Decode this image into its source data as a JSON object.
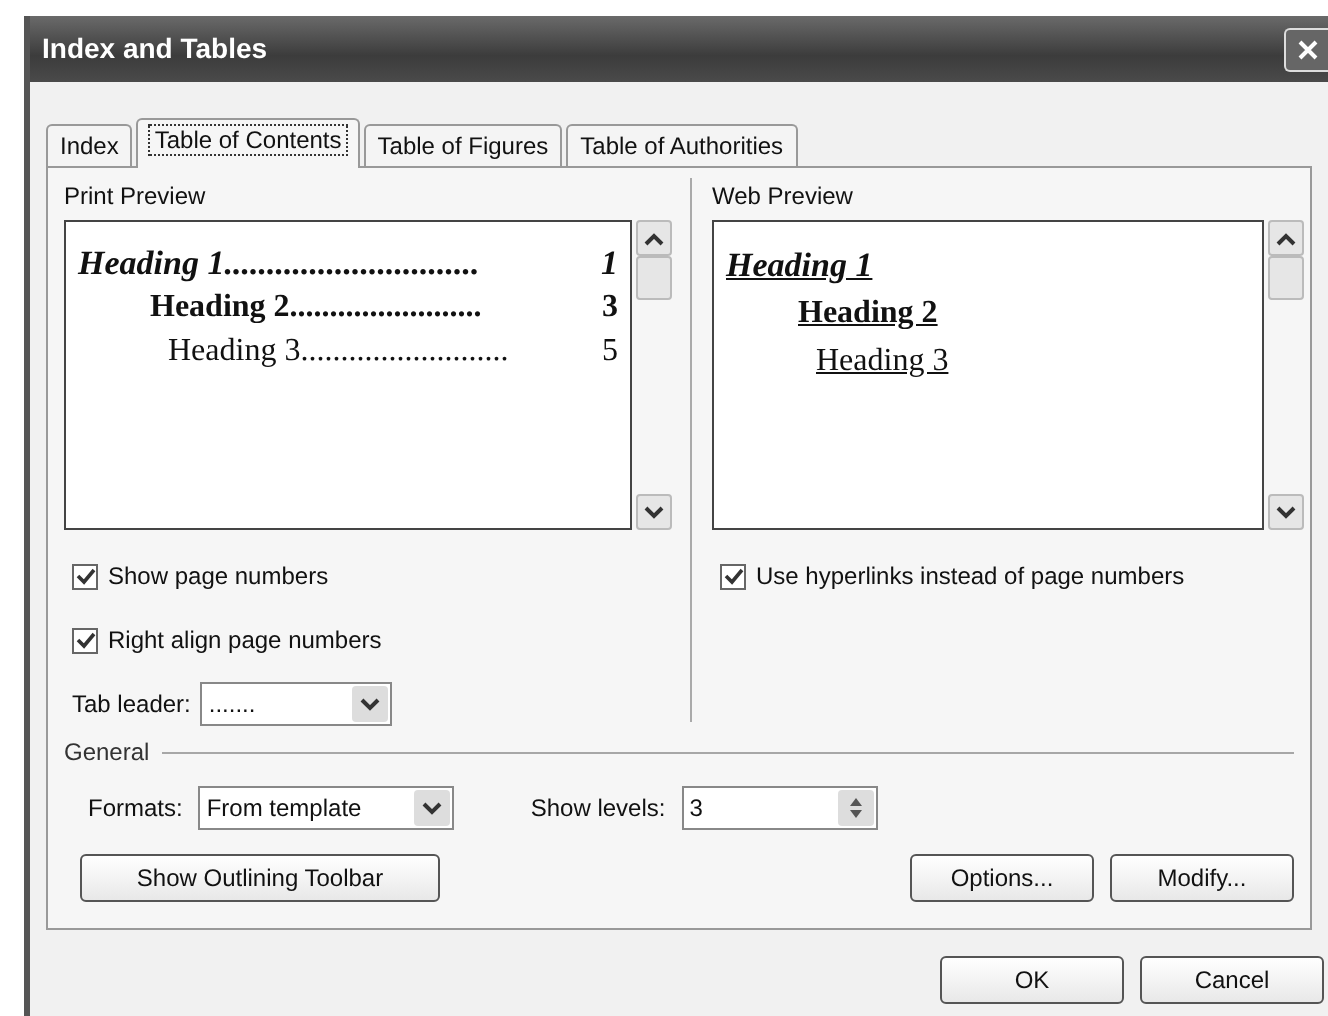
{
  "window": {
    "title": "Index and Tables"
  },
  "tabs": [
    {
      "label": "Index",
      "selected": false
    },
    {
      "label": "Table of Contents",
      "selected": true
    },
    {
      "label": "Table of Figures",
      "selected": false
    },
    {
      "label": "Table of Authorities",
      "selected": false
    }
  ],
  "print_preview": {
    "label": "Print Preview",
    "entries": [
      {
        "kind": "h1",
        "text": "Heading 1",
        "leader": "..............................",
        "page": "1"
      },
      {
        "kind": "h2",
        "text": "Heading 2",
        "leader": "........................",
        "page": "3"
      },
      {
        "kind": "h3",
        "text": "Heading 3",
        "leader": "..........................",
        "page": "5"
      }
    ]
  },
  "web_preview": {
    "label": "Web Preview",
    "entries": [
      {
        "kind": "h1",
        "text": "Heading 1"
      },
      {
        "kind": "h2",
        "text": "Heading 2"
      },
      {
        "kind": "h3",
        "text": "Heading 3"
      }
    ]
  },
  "left_options": [
    {
      "label": "Show page numbers",
      "checked": true
    },
    {
      "label": "Right align page numbers",
      "checked": true
    }
  ],
  "right_options": [
    {
      "label": "Use hyperlinks instead of page numbers",
      "checked": true
    }
  ],
  "tab_leader": {
    "label": "Tab leader:",
    "value": "......."
  },
  "general": {
    "label": "General",
    "formats_label": "Formats:",
    "formats_value": "From template",
    "levels_label": "Show levels:",
    "levels_value": "3"
  },
  "action_buttons": [
    "Show Outlining Toolbar",
    "Options...",
    "Modify..."
  ],
  "footer_buttons": [
    "OK",
    "Cancel"
  ]
}
